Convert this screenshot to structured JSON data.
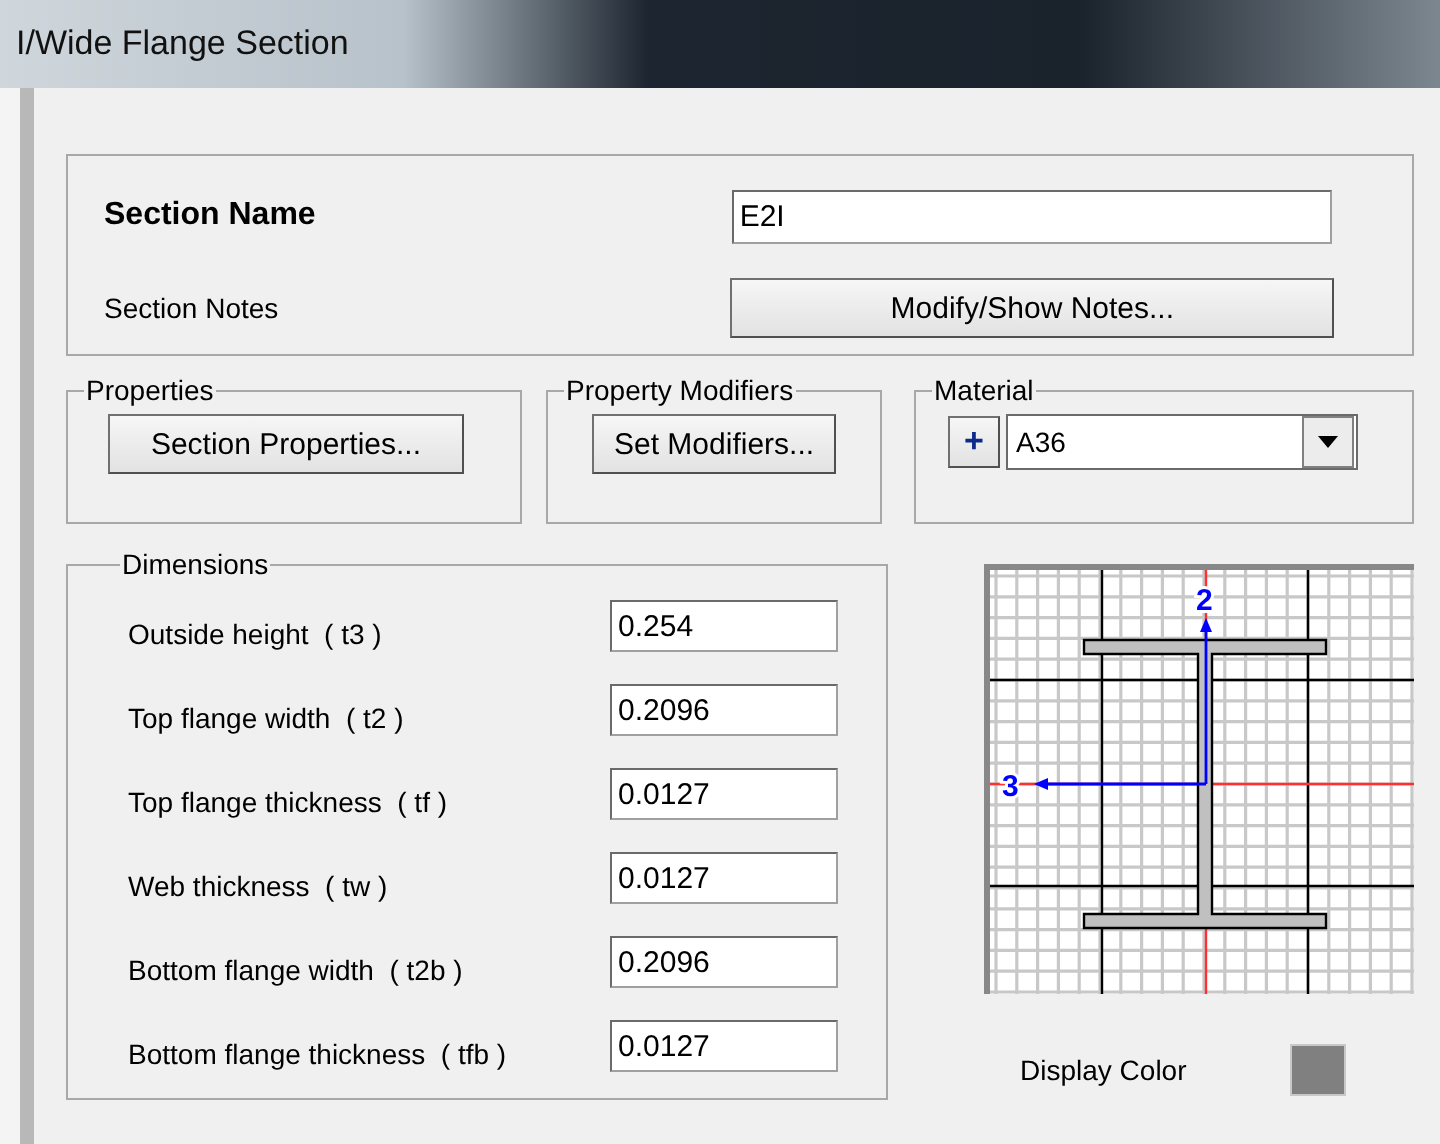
{
  "window": {
    "title": "I/Wide Flange Section"
  },
  "section_name": {
    "label": "Section Name",
    "value": "E2I"
  },
  "section_notes": {
    "label": "Section Notes",
    "button": "Modify/Show Notes..."
  },
  "properties": {
    "title": "Properties",
    "button": "Section Properties..."
  },
  "property_modifiers": {
    "title": "Property Modifiers",
    "button": "Set Modifiers..."
  },
  "material": {
    "title": "Material",
    "add_button": "+",
    "value": "A36"
  },
  "dimensions": {
    "title": "Dimensions",
    "rows": [
      {
        "label": "Outside height  ( t3 )",
        "value": "0.254"
      },
      {
        "label": "Top flange width  ( t2 )",
        "value": "0.2096"
      },
      {
        "label": "Top flange thickness  ( tf )",
        "value": "0.0127"
      },
      {
        "label": "Web thickness  ( tw )",
        "value": "0.0127"
      },
      {
        "label": "Bottom flange width  ( t2b )",
        "value": "0.2096"
      },
      {
        "label": "Bottom flange thickness  ( tfb )",
        "value": "0.0127"
      }
    ]
  },
  "preview": {
    "vertical_axis_label": "2",
    "horizontal_axis_label": "3"
  },
  "display_color": {
    "label": "Display Color",
    "color": "#808080"
  }
}
